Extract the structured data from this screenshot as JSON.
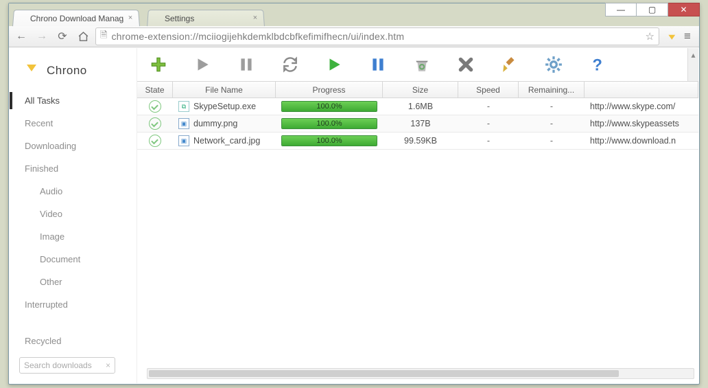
{
  "window": {
    "tabs": [
      {
        "title": "Chrono Download Manag",
        "active": true
      },
      {
        "title": "Settings",
        "active": false
      }
    ],
    "url": "chrome-extension://mciiogijehkdemklbdcbfkefimifhecn/ui/index.htm"
  },
  "sidebar": {
    "logo": "Chrono",
    "items": [
      {
        "label": "All Tasks",
        "active": true
      },
      {
        "label": "Recent"
      },
      {
        "label": "Downloading"
      },
      {
        "label": "Finished"
      },
      {
        "label": "Audio",
        "sub": true
      },
      {
        "label": "Video",
        "sub": true
      },
      {
        "label": "Image",
        "sub": true
      },
      {
        "label": "Document",
        "sub": true
      },
      {
        "label": "Other",
        "sub": true
      },
      {
        "label": "Interrupted"
      },
      {
        "label": "Recycled",
        "spaced": true
      }
    ],
    "search_placeholder": "Search downloads"
  },
  "toolbar_icons": [
    "add",
    "start",
    "pause",
    "restart",
    "start-all",
    "pause-all",
    "trash",
    "delete",
    "sweep",
    "settings",
    "help"
  ],
  "table": {
    "headers": {
      "state": "State",
      "file": "File Name",
      "progress": "Progress",
      "size": "Size",
      "speed": "Speed",
      "remaining": "Remaining...",
      "url": ""
    },
    "rows": [
      {
        "file": "SkypeSetup.exe",
        "icon": "exe",
        "progress": "100.0%",
        "size": "1.6MB",
        "speed": "-",
        "remaining": "-",
        "url": "http://www.skype.com/"
      },
      {
        "file": "dummy.png",
        "icon": "img",
        "progress": "100.0%",
        "size": "137B",
        "speed": "-",
        "remaining": "-",
        "url": "http://www.skypeassets"
      },
      {
        "file": "Network_card.jpg",
        "icon": "img",
        "progress": "100.0%",
        "size": "99.59KB",
        "speed": "-",
        "remaining": "-",
        "url": "http://www.download.n"
      }
    ]
  }
}
